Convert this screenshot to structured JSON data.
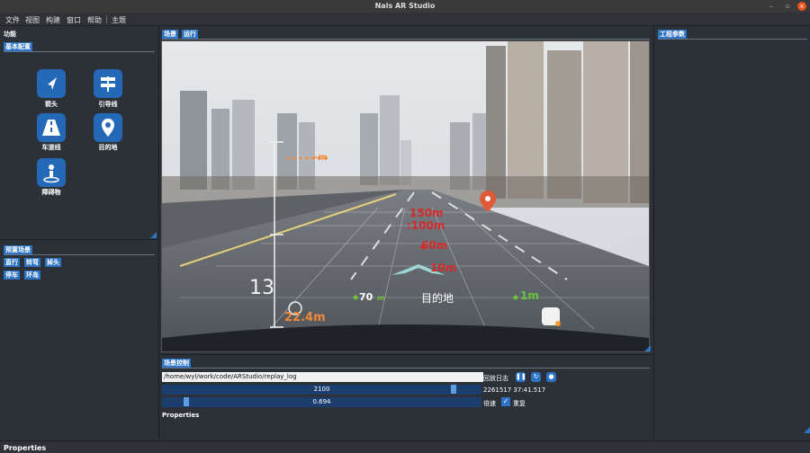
{
  "window": {
    "title": "Nals AR Studio"
  },
  "menu": {
    "items": [
      "文件",
      "视图",
      "构建",
      "窗口",
      "帮助",
      "主题"
    ]
  },
  "left_panel": {
    "header": "功能",
    "basic_config": {
      "label": "基本配置",
      "tools": [
        {
          "label": "箭头",
          "icon": "arrow-nav-icon"
        },
        {
          "label": "引导线",
          "icon": "signpost-icon"
        },
        {
          "label": "车道线",
          "icon": "road-icon"
        },
        {
          "label": "目的地",
          "icon": "location-pin-icon"
        },
        {
          "label": "障碍物",
          "icon": "person-obstacle-icon"
        }
      ]
    },
    "preset_scenes": {
      "label": "预置场景",
      "buttons": [
        "直行",
        "转弯",
        "掉头",
        "停车",
        "环岛"
      ]
    }
  },
  "scene_panel": {
    "tabs": [
      "场景",
      "运行"
    ],
    "overlay": {
      "scale_number": "13",
      "dashed_label": "--m",
      "distances_red": [
        "150m",
        ":100m",
        "60m",
        "10m"
      ],
      "left_green": "70",
      "left_green_unit": "m",
      "destination": "目的地",
      "right_green": "1m",
      "orange": "22.4m"
    }
  },
  "right_panel": {
    "label": "工程参数"
  },
  "scene_control": {
    "label": "场景控制",
    "path": "/home/wyl/work/code/ARStudio/replay_log",
    "frame_value": "2100",
    "frame_fraction": 0.92,
    "speed_value": "0.694",
    "speed_fraction": 0.07,
    "playback_label": "回放日志",
    "timestamp": "2261517 37:41.517",
    "speed_label": "倍速",
    "repeat_label": "重复",
    "repeat_checked": true,
    "properties_label": "Properties"
  },
  "bottom_label": "Properties"
}
